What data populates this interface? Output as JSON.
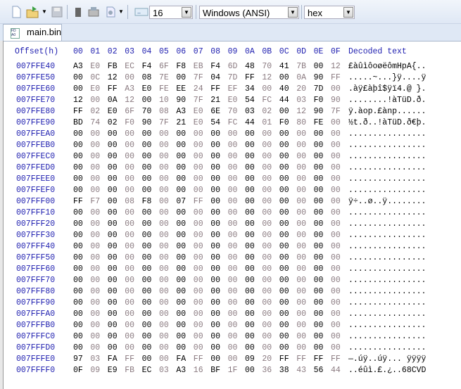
{
  "toolbar": {
    "bytes_per_row": "16",
    "charset": "Windows (ANSI)",
    "display": "hex",
    "icons": [
      "new-file-icon",
      "open-file-icon",
      "save-icon",
      "ram-icon",
      "disk-icon",
      "export-icon",
      "bytes-per-row-icon"
    ]
  },
  "tab": {
    "label": "main.bin"
  },
  "header": {
    "offset": "Offset(h)",
    "columns": [
      "00",
      "01",
      "02",
      "03",
      "04",
      "05",
      "06",
      "07",
      "08",
      "09",
      "0A",
      "0B",
      "0C",
      "0D",
      "0E",
      "0F"
    ],
    "decoded": "Decoded text"
  },
  "rows": [
    {
      "offset": "007FFE40",
      "bytes": [
        "A3",
        "E0",
        "FB",
        "EC",
        "F4",
        "6F",
        "F8",
        "EB",
        "F4",
        "6D",
        "48",
        "70",
        "41",
        "7B",
        "00",
        "12"
      ],
      "text": "£àûìôoøëômHpA{.."
    },
    {
      "offset": "007FFE50",
      "bytes": [
        "00",
        "0C",
        "12",
        "00",
        "08",
        "7E",
        "00",
        "7F",
        "04",
        "7D",
        "FF",
        "12",
        "00",
        "0A",
        "90",
        "FF"
      ],
      "text": ".....~...}ÿ....ÿ"
    },
    {
      "offset": "007FFE60",
      "bytes": [
        "00",
        "E0",
        "FF",
        "A3",
        "E0",
        "FE",
        "EE",
        "24",
        "FF",
        "EF",
        "34",
        "00",
        "40",
        "20",
        "7D",
        "00"
      ],
      "text": ".àÿ£àþî$ÿï4.@ }."
    },
    {
      "offset": "007FFE70",
      "bytes": [
        "12",
        "00",
        "0A",
        "12",
        "00",
        "10",
        "90",
        "7F",
        "21",
        "E0",
        "54",
        "FC",
        "44",
        "03",
        "F0",
        "90"
      ],
      "text": "........!àTüD.ð."
    },
    {
      "offset": "007FFE80",
      "bytes": [
        "FF",
        "02",
        "E0",
        "6F",
        "70",
        "08",
        "A3",
        "E0",
        "6E",
        "70",
        "03",
        "02",
        "00",
        "12",
        "90",
        "7F"
      ],
      "text": "ÿ.àop.£ànp......"
    },
    {
      "offset": "007FFE90",
      "bytes": [
        "BD",
        "74",
        "02",
        "F0",
        "90",
        "7F",
        "21",
        "E0",
        "54",
        "FC",
        "44",
        "01",
        "F0",
        "80",
        "FE",
        "00"
      ],
      "text": "½t.ð..!àTüD.ð€þ."
    },
    {
      "offset": "007FFEA0",
      "bytes": [
        "00",
        "00",
        "00",
        "00",
        "00",
        "00",
        "00",
        "00",
        "00",
        "00",
        "00",
        "00",
        "00",
        "00",
        "00",
        "00"
      ],
      "text": "................"
    },
    {
      "offset": "007FFEB0",
      "bytes": [
        "00",
        "00",
        "00",
        "00",
        "00",
        "00",
        "00",
        "00",
        "00",
        "00",
        "00",
        "00",
        "00",
        "00",
        "00",
        "00"
      ],
      "text": "................"
    },
    {
      "offset": "007FFEC0",
      "bytes": [
        "00",
        "00",
        "00",
        "00",
        "00",
        "00",
        "00",
        "00",
        "00",
        "00",
        "00",
        "00",
        "00",
        "00",
        "00",
        "00"
      ],
      "text": "................"
    },
    {
      "offset": "007FFED0",
      "bytes": [
        "00",
        "00",
        "00",
        "00",
        "00",
        "00",
        "00",
        "00",
        "00",
        "00",
        "00",
        "00",
        "00",
        "00",
        "00",
        "00"
      ],
      "text": "................"
    },
    {
      "offset": "007FFEE0",
      "bytes": [
        "00",
        "00",
        "00",
        "00",
        "00",
        "00",
        "00",
        "00",
        "00",
        "00",
        "00",
        "00",
        "00",
        "00",
        "00",
        "00"
      ],
      "text": "................"
    },
    {
      "offset": "007FFEF0",
      "bytes": [
        "00",
        "00",
        "00",
        "00",
        "00",
        "00",
        "00",
        "00",
        "00",
        "00",
        "00",
        "00",
        "00",
        "00",
        "00",
        "00"
      ],
      "text": "................"
    },
    {
      "offset": "007FFF00",
      "bytes": [
        "FF",
        "F7",
        "00",
        "08",
        "F8",
        "00",
        "07",
        "FF",
        "00",
        "00",
        "00",
        "00",
        "00",
        "00",
        "00",
        "00"
      ],
      "text": "ÿ÷..ø..ÿ........"
    },
    {
      "offset": "007FFF10",
      "bytes": [
        "00",
        "00",
        "00",
        "00",
        "00",
        "00",
        "00",
        "00",
        "00",
        "00",
        "00",
        "00",
        "00",
        "00",
        "00",
        "00"
      ],
      "text": "................"
    },
    {
      "offset": "007FFF20",
      "bytes": [
        "00",
        "00",
        "00",
        "00",
        "00",
        "00",
        "00",
        "00",
        "00",
        "00",
        "00",
        "00",
        "00",
        "00",
        "00",
        "00"
      ],
      "text": "................"
    },
    {
      "offset": "007FFF30",
      "bytes": [
        "00",
        "00",
        "00",
        "00",
        "00",
        "00",
        "00",
        "00",
        "00",
        "00",
        "00",
        "00",
        "00",
        "00",
        "00",
        "00"
      ],
      "text": "................"
    },
    {
      "offset": "007FFF40",
      "bytes": [
        "00",
        "00",
        "00",
        "00",
        "00",
        "00",
        "00",
        "00",
        "00",
        "00",
        "00",
        "00",
        "00",
        "00",
        "00",
        "00"
      ],
      "text": "................"
    },
    {
      "offset": "007FFF50",
      "bytes": [
        "00",
        "00",
        "00",
        "00",
        "00",
        "00",
        "00",
        "00",
        "00",
        "00",
        "00",
        "00",
        "00",
        "00",
        "00",
        "00"
      ],
      "text": "................"
    },
    {
      "offset": "007FFF60",
      "bytes": [
        "00",
        "00",
        "00",
        "00",
        "00",
        "00",
        "00",
        "00",
        "00",
        "00",
        "00",
        "00",
        "00",
        "00",
        "00",
        "00"
      ],
      "text": "................"
    },
    {
      "offset": "007FFF70",
      "bytes": [
        "00",
        "00",
        "00",
        "00",
        "00",
        "00",
        "00",
        "00",
        "00",
        "00",
        "00",
        "00",
        "00",
        "00",
        "00",
        "00"
      ],
      "text": "................"
    },
    {
      "offset": "007FFF80",
      "bytes": [
        "00",
        "00",
        "00",
        "00",
        "00",
        "00",
        "00",
        "00",
        "00",
        "00",
        "00",
        "00",
        "00",
        "00",
        "00",
        "00"
      ],
      "text": "................"
    },
    {
      "offset": "007FFF90",
      "bytes": [
        "00",
        "00",
        "00",
        "00",
        "00",
        "00",
        "00",
        "00",
        "00",
        "00",
        "00",
        "00",
        "00",
        "00",
        "00",
        "00"
      ],
      "text": "................"
    },
    {
      "offset": "007FFFA0",
      "bytes": [
        "00",
        "00",
        "00",
        "00",
        "00",
        "00",
        "00",
        "00",
        "00",
        "00",
        "00",
        "00",
        "00",
        "00",
        "00",
        "00"
      ],
      "text": "................"
    },
    {
      "offset": "007FFFB0",
      "bytes": [
        "00",
        "00",
        "00",
        "00",
        "00",
        "00",
        "00",
        "00",
        "00",
        "00",
        "00",
        "00",
        "00",
        "00",
        "00",
        "00"
      ],
      "text": "................"
    },
    {
      "offset": "007FFFC0",
      "bytes": [
        "00",
        "00",
        "00",
        "00",
        "00",
        "00",
        "00",
        "00",
        "00",
        "00",
        "00",
        "00",
        "00",
        "00",
        "00",
        "00"
      ],
      "text": "................"
    },
    {
      "offset": "007FFFD0",
      "bytes": [
        "00",
        "00",
        "00",
        "00",
        "00",
        "00",
        "00",
        "00",
        "00",
        "00",
        "00",
        "00",
        "00",
        "00",
        "00",
        "00"
      ],
      "text": "................"
    },
    {
      "offset": "007FFFE0",
      "bytes": [
        "97",
        "03",
        "FA",
        "FF",
        "00",
        "00",
        "FA",
        "FF",
        "00",
        "00",
        "09",
        "20",
        "FF",
        "FF",
        "FF",
        "FF"
      ],
      "text": "—.úÿ..úÿ... ÿÿÿÿ"
    },
    {
      "offset": "007FFFF0",
      "bytes": [
        "0F",
        "09",
        "E9",
        "FB",
        "EC",
        "03",
        "A3",
        "16",
        "BF",
        "1F",
        "00",
        "36",
        "38",
        "43",
        "56",
        "44"
      ],
      "text": "..éûì.£.¿..68CVD"
    }
  ]
}
